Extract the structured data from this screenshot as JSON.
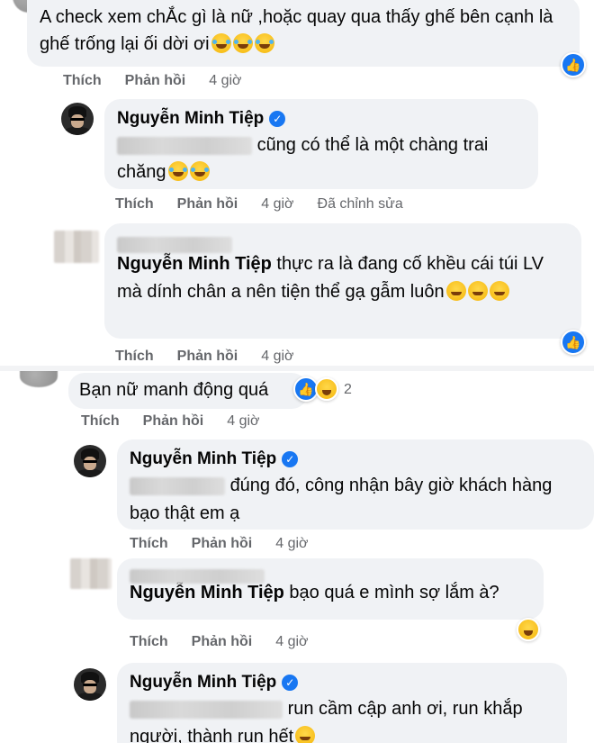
{
  "comments_top": {
    "c1": {
      "text": "A check xem chẮc gì là nữ ,hoặc quay qua thấy ghế bên cạnh là ghế trống lại ối dời ơi",
      "actions": {
        "like": "Thích",
        "reply": "Phản hồi",
        "time": "4 giờ"
      }
    },
    "c2": {
      "author": "Nguyễn Minh Tiệp",
      "text": "cũng có thể là một chàng trai chăng",
      "actions": {
        "like": "Thích",
        "reply": "Phản hồi",
        "time": "4 giờ",
        "edited": "Đã chỉnh sửa"
      }
    },
    "c3": {
      "author_inline": "Nguyễn Minh Tiệp",
      "text": "thực ra là đang cố khều cái túi LV mà dính chân a nên tiện thể gạ gẫm luôn",
      "actions": {
        "like": "Thích",
        "reply": "Phản hồi",
        "time": "4 giờ"
      }
    }
  },
  "comments_bottom": {
    "c4": {
      "text": "Bạn nữ manh động quá",
      "reaction_count": "2",
      "actions": {
        "like": "Thích",
        "reply": "Phản hồi",
        "time": "4 giờ"
      }
    },
    "c5": {
      "author": "Nguyễn Minh Tiệp",
      "text_line1": "đúng đó, công nhận bây giờ khách hàng",
      "text_line2": "bạo thật em ạ",
      "actions": {
        "like": "Thích",
        "reply": "Phản hồi",
        "time": "4 giờ"
      }
    },
    "c6": {
      "author_inline": "Nguyễn Minh Tiệp",
      "text": "bạo quá e mình sợ lắm à?",
      "actions": {
        "like": "Thích",
        "reply": "Phản hồi",
        "time": "4 giờ"
      }
    },
    "c7": {
      "author": "Nguyễn Minh Tiệp",
      "text_line1": "run cầm cập anh ơi, run khắp",
      "text_line2": "người, thành run hết"
    }
  },
  "icons": {
    "verified": "verified-badge-icon",
    "like_reaction": "like-reaction-icon",
    "laugh_reaction": "laugh-reaction-icon",
    "emoji_rofl": "rofl-emoji-icon",
    "emoji_smile": "smile-emoji-icon"
  },
  "colors": {
    "bubble": "#f0f2f5",
    "meta_text": "#65676b",
    "accent_blue": "#1877f2"
  }
}
